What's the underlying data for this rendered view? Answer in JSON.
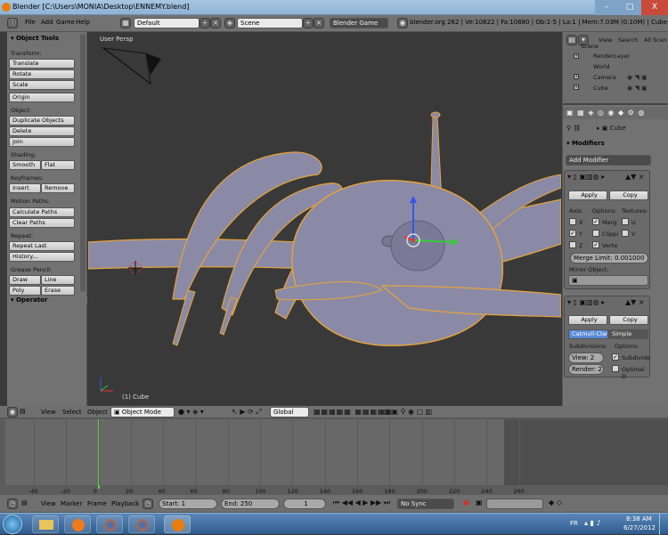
{
  "window": {
    "title": "Blender [C:\\Users\\MONIA\\Desktop\\ENNEMY.blend]",
    "controls": [
      "–",
      "□",
      "X"
    ]
  },
  "topbar": {
    "menus": [
      "File",
      "Add",
      "Game",
      "Help"
    ],
    "layout": "Default",
    "scene": "Scene",
    "engine": "Blender Game",
    "stats": "blender.org 262 | Ve:10822 | Fa:10880 | Ob:1-5 | La:1 | Mem:7.03M (0.10M) | Cube"
  },
  "tools": {
    "title": "Object Tools",
    "sections": {
      "transform": "Transform:",
      "object": "Object:",
      "shading": "Shading:",
      "keyframes": "Keyframes:",
      "motion_paths": "Motion Paths:",
      "repeat": "Repeat:",
      "grease_pencil": "Grease Pencil:"
    },
    "buttons": {
      "translate": "Translate",
      "rotate": "Rotate",
      "scale": "Scale",
      "origin": "Origin",
      "duplicate": "Duplicate Objects",
      "delete": "Delete",
      "join": "Join",
      "smooth": "Smooth",
      "flat": "Flat",
      "insert": "Insert",
      "remove": "Remove",
      "calc_paths": "Calculate Paths",
      "clear_paths": "Clear Paths",
      "repeat_last": "Repeat Last",
      "history": "History...",
      "draw": "Draw",
      "line": "Line",
      "poly": "Poly",
      "erase": "Erase"
    },
    "operator": "Operator"
  },
  "viewport": {
    "view_name": "User Persp",
    "object_label": "(1) Cube"
  },
  "outliner": {
    "menus": [
      "View",
      "Search",
      "All Scen"
    ],
    "items": [
      "Scene",
      "RenderLayer",
      "World",
      "Camera",
      "Cube"
    ]
  },
  "properties": {
    "breadcrumb": "Cube",
    "modifiers_title": "Modifiers",
    "add_modifier": "Add Modifier",
    "mirror": {
      "apply": "Apply",
      "copy": "Copy",
      "axis_label": "Axis:",
      "options_label": "Options:",
      "textures_label": "Textures:",
      "x": "X",
      "y": "Y",
      "z": "Z",
      "merge": "Merg",
      "clipping": "Clippi",
      "vertex": "Verte",
      "u": "U",
      "v": "V",
      "merge_limit": "Merge Limit: 0.001000",
      "mirror_object": "Mirror Object:"
    },
    "subsurf": {
      "apply": "Apply",
      "copy": "Copy",
      "catmull": "Catmull-Clark",
      "simple": "Simple",
      "subdivisions_label": "Subdivisions:",
      "options_label": "Options:",
      "view": "View: 2",
      "render": "Render: 2",
      "subdivide_uvs": "Subdivide",
      "optimal": "Optimal D"
    }
  },
  "viewport_header": {
    "menus": [
      "View",
      "Select",
      "Object"
    ],
    "mode": "Object Mode",
    "orientation": "Global"
  },
  "timeline": {
    "ticks": [
      "-40",
      "-20",
      "0",
      "20",
      "40",
      "60",
      "80",
      "100",
      "120",
      "140",
      "160",
      "180",
      "200",
      "220",
      "240",
      "260"
    ],
    "menus": [
      "View",
      "Marker",
      "Frame",
      "Playback"
    ],
    "start": "Start: 1",
    "end": "End: 250",
    "current": "1",
    "sync": "No Sync"
  },
  "taskbar": {
    "lang": "FR",
    "time": "8:38 AM",
    "date": "6/27/2012"
  },
  "colors": {
    "selection_outline": "#e8a33a",
    "mesh": "#8a8aa6",
    "accent_blue": "#5a8ad6"
  }
}
